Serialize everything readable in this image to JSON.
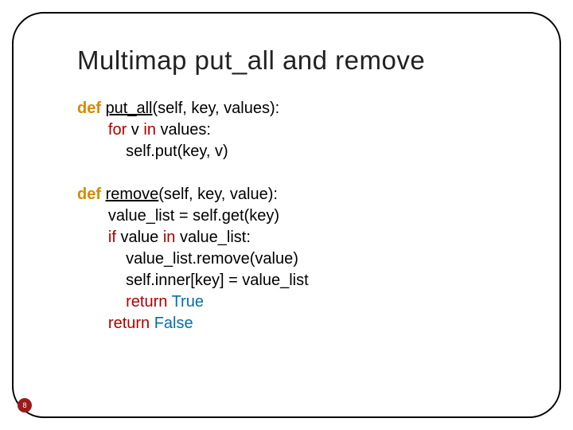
{
  "title": "Multimap put_all and remove",
  "code1": {
    "def": "def",
    "fname": "put_all",
    "sig_rest": "(self, key, values):",
    "for": "for",
    "for_var": " v ",
    "in": "in",
    "for_iter": " values:",
    "body": "self.put(key, v)"
  },
  "code2": {
    "def": "def",
    "fname": "remove",
    "sig_rest": "(self, key, value):",
    "l1": "value_list = self.get(key)",
    "if": "if",
    "if_cond_a": " value ",
    "in": "in",
    "if_cond_b": " value_list:",
    "l3": "value_list.remove(value)",
    "l4": "self.inner[key] = value_list",
    "return1": "return",
    "true": "True",
    "return2": "return",
    "false": "False"
  },
  "page_number": "8"
}
